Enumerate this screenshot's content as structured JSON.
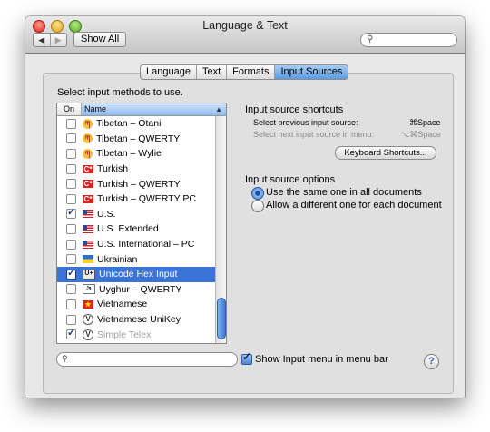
{
  "window": {
    "title": "Language & Text",
    "toolbar": {
      "back_glyph": "◀",
      "forward_glyph": "▶",
      "show_all": "Show All",
      "search_placeholder": ""
    }
  },
  "tabs": [
    {
      "label": "Language",
      "active": false
    },
    {
      "label": "Text",
      "active": false
    },
    {
      "label": "Formats",
      "active": false
    },
    {
      "label": "Input Sources",
      "active": true
    }
  ],
  "input_methods": {
    "prompt": "Select input methods to use.",
    "columns": {
      "on": "On",
      "name": "Name",
      "sort_glyph": "▲"
    },
    "rows": [
      {
        "name": "Tibetan – Otani",
        "checked": false,
        "icon": "tibet",
        "glyph": "ཀ"
      },
      {
        "name": "Tibetan – QWERTY",
        "checked": false,
        "icon": "tibet",
        "glyph": "ཀ"
      },
      {
        "name": "Tibetan – Wylie",
        "checked": false,
        "icon": "tibet",
        "glyph": "ཀ"
      },
      {
        "name": "Turkish",
        "checked": false,
        "icon": "turkey",
        "glyph": "C*"
      },
      {
        "name": "Turkish – QWERTY",
        "checked": false,
        "icon": "turkey",
        "glyph": "C*"
      },
      {
        "name": "Turkish – QWERTY PC",
        "checked": false,
        "icon": "turkey",
        "glyph": "C*"
      },
      {
        "name": "U.S.",
        "checked": true,
        "icon": "us",
        "glyph": ""
      },
      {
        "name": "U.S. Extended",
        "checked": false,
        "icon": "us",
        "glyph": ""
      },
      {
        "name": "U.S. International – PC",
        "checked": false,
        "icon": "us",
        "glyph": ""
      },
      {
        "name": "Ukrainian",
        "checked": false,
        "icon": "ua",
        "glyph": ""
      },
      {
        "name": "Unicode Hex Input",
        "checked": true,
        "icon": "uni",
        "glyph": "U+",
        "selected": true
      },
      {
        "name": "Uyghur – QWERTY",
        "checked": false,
        "icon": "uyg",
        "glyph": "ئ"
      },
      {
        "name": "Vietnamese",
        "checked": false,
        "icon": "vn",
        "glyph": "★"
      },
      {
        "name": "Vietnamese UniKey",
        "checked": false,
        "icon": "globe",
        "glyph": "V"
      },
      {
        "name": "Simple Telex",
        "checked": true,
        "icon": "globe",
        "glyph": "V",
        "dim": true
      }
    ],
    "filter_placeholder": ""
  },
  "shortcuts": {
    "title": "Input source shortcuts",
    "prev_label": "Select previous input source:",
    "prev_key": "⌘Space",
    "next_label": "Select next input source in menu:",
    "next_key": "⌥⌘Space",
    "keyboard_button": "Keyboard Shortcuts..."
  },
  "options": {
    "title": "Input source options",
    "same_label": "Use the same one in all documents",
    "different_label": "Allow a different one for each document",
    "selected": "same"
  },
  "show_menu": {
    "label": "Show Input menu in menu bar",
    "checked": true
  },
  "help_glyph": "?"
}
